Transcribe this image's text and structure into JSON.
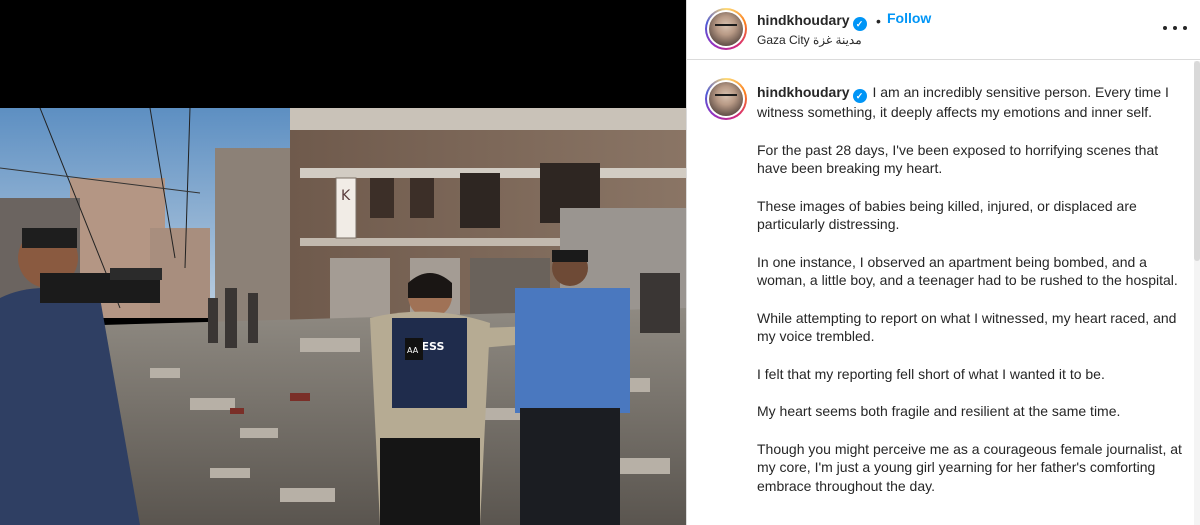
{
  "post": {
    "username": "hindkhoudary",
    "verified_glyph": "✓",
    "follow_label": "Follow",
    "separator": "•",
    "location": "Gaza City مدينة غزة"
  },
  "caption": {
    "username": "hindkhoudary",
    "paragraphs": [
      "I am an incredibly sensitive person. Every time I witness something, it deeply affects my emotions and inner self.",
      "For the past 28 days, I've been exposed to horrifying scenes that have been breaking my heart.",
      "These images of babies being killed, injured, or displaced are particularly distressing.",
      "In one instance, I observed an apartment being bombed, and a woman, a little boy, and a teenager had to be rushed to the hospital.",
      "While attempting to report on what I witnessed, my heart raced, and my voice trembled.",
      "I felt that my reporting fell short of what I wanted it to be.",
      "My heart seems both fragile and resilient at the same time.",
      "Though you might perceive me as a courageous female journalist, at my core, I'm just a young girl yearning for her father's comforting embrace throughout the day."
    ]
  },
  "photo": {
    "vest_label": "PRESS",
    "mic_label": "AA",
    "sign_letter": "K"
  },
  "icons": {
    "verified": "verified-badge-icon",
    "more": "more-options-icon"
  },
  "colors": {
    "accent": "#0095f6",
    "text": "#262626",
    "border": "#dbdbdb"
  }
}
